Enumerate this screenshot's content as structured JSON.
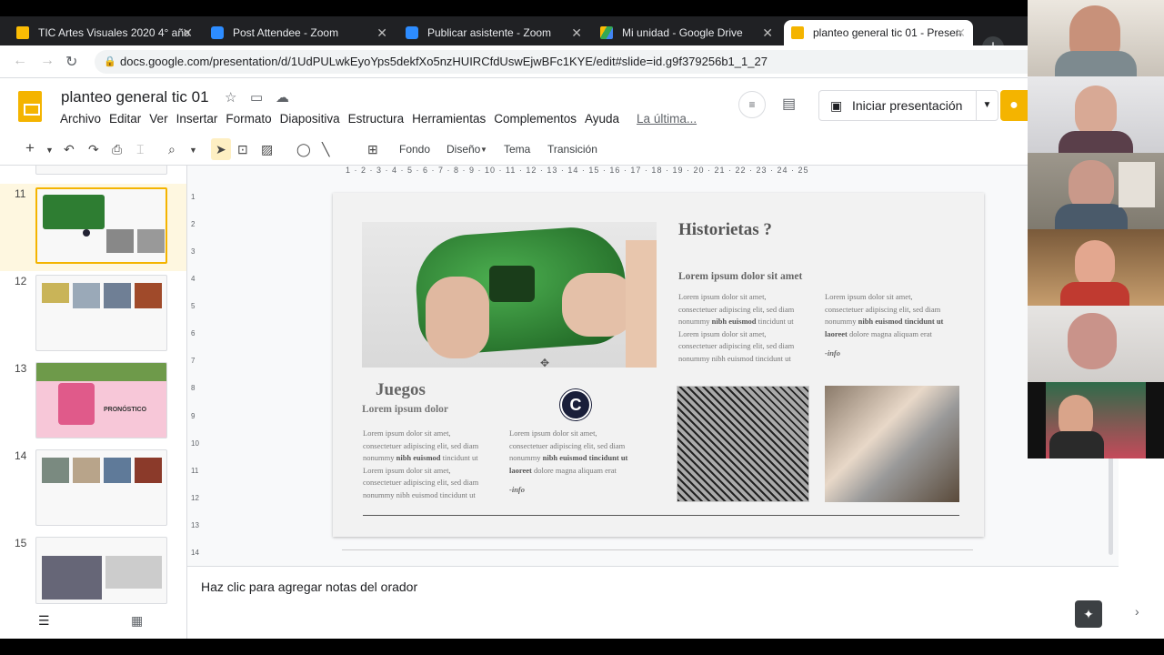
{
  "browser": {
    "tabs": [
      {
        "title": "TIC Artes Visuales 2020 4° año",
        "color": "#fbbc04"
      },
      {
        "title": "Post Attendee - Zoom",
        "color": "#2d8cff"
      },
      {
        "title": "Publicar asistente - Zoom",
        "color": "#2d8cff"
      },
      {
        "title": "Mi unidad - Google Drive",
        "color": "#34a853"
      },
      {
        "title": "planteo general tic 01 - Presen",
        "color": "#f4b400"
      }
    ],
    "url": "docs.google.com/presentation/d/1UdPULwkEyoYps5dekfXo5nzHUIRCfdUswEjwBFc1KYE/edit#slide=id.g9f379256b1_1_27"
  },
  "app": {
    "title": "planteo general tic 01",
    "menu": [
      "Archivo",
      "Editar",
      "Ver",
      "Insertar",
      "Formato",
      "Diapositiva",
      "Estructura",
      "Herramientas",
      "Complementos",
      "Ayuda"
    ],
    "last_edit": "La última...",
    "present_label": "Iniciar presentación"
  },
  "toolbar": {
    "fondo": "Fondo",
    "diseno": "Diseño",
    "tema": "Tema",
    "transicion": "Transición"
  },
  "filmstrip": {
    "slides": [
      {
        "num": "11",
        "selected": true
      },
      {
        "num": "12",
        "selected": false
      },
      {
        "num": "13",
        "selected": false,
        "label": "PRONÓSTICO"
      },
      {
        "num": "14",
        "selected": false
      },
      {
        "num": "15",
        "selected": false
      }
    ]
  },
  "ruler": {
    "h": "1 · 2 · 3 · 4 · 5 · 6 · 7 · 8 · 9 · 10 · 11 · 12 · 13 · 14 · 15 · 16 · 17 · 18 · 19 · 20 · 21 · 22 · 23 · 24 · 25",
    "v": [
      "1",
      "2",
      "3",
      "4",
      "5",
      "6",
      "7",
      "8",
      "9",
      "10",
      "11",
      "12",
      "13",
      "14"
    ]
  },
  "slide": {
    "heading_right": "Historietas ?",
    "subheading_right": "Lorem ipsum dolor sit amet",
    "col1_line1": "Lorem ipsum dolor sit amet,",
    "col1_line2": "consectetuer adipiscing elit, sed diam",
    "col1_line3_pre": "nonummy ",
    "col1_line3_bold": "nibh euismod",
    "col1_line3_post": " tincidunt ut",
    "col1_line4": "Lorem ipsum dolor sit amet,",
    "col1_line5": "consectetuer adipiscing elit, sed diam",
    "col1_line6": "nonummy nibh euismod tincidunt ut",
    "col2_line1": "Lorem ipsum dolor sit amet,",
    "col2_line2": "consectetuer adipiscing elit, sed diam",
    "col2_line3_pre": "nonummy ",
    "col2_line3_bold": "nibh euismod tincidunt ut",
    "col2_line4_bold": "laoreet",
    "col2_line4_post": " dolore magna aliquam erat",
    "info": "-info",
    "heading_left": "Juegos",
    "subheading_left": "Lorem ipsum dolor",
    "logo_letter": "C"
  },
  "notes": {
    "placeholder": "Haz clic para agregar notas del orador"
  }
}
